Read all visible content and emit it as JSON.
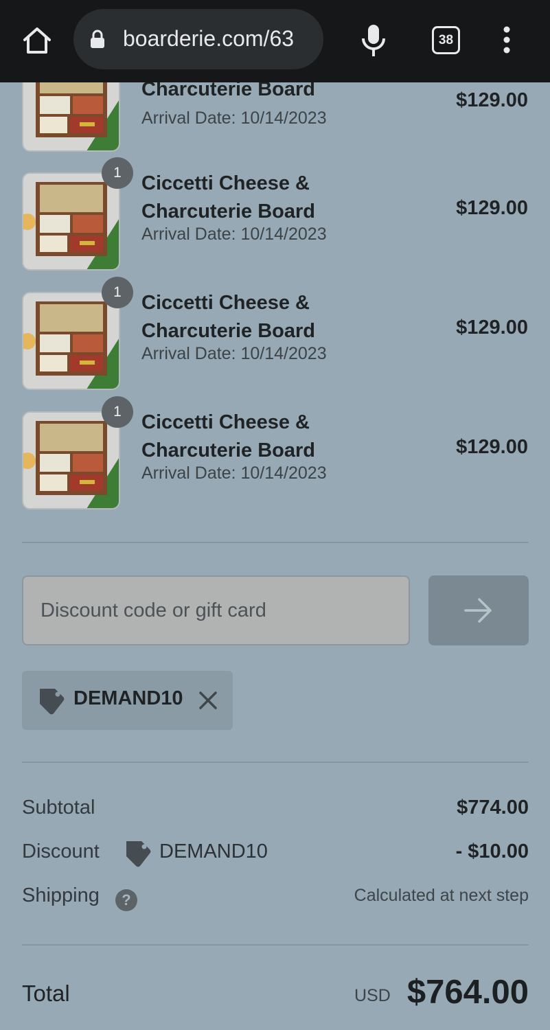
{
  "browser": {
    "url": "boarderie.com/63",
    "tab_count": "38"
  },
  "items": [
    {
      "name": "Charcuterie Board",
      "arrival": "Arrival Date: 10/14/2023",
      "price": "$129.00",
      "quantity": ""
    },
    {
      "name": "Ciccetti Cheese & Charcuterie Board",
      "arrival": "Arrival Date: 10/14/2023",
      "price": "$129.00",
      "quantity": "1"
    },
    {
      "name": "Ciccetti Cheese & Charcuterie Board",
      "arrival": "Arrival Date: 10/14/2023",
      "price": "$129.00",
      "quantity": "1"
    },
    {
      "name": "Ciccetti Cheese & Charcuterie Board",
      "arrival": "Arrival Date: 10/14/2023",
      "price": "$129.00",
      "quantity": "1"
    }
  ],
  "discount": {
    "placeholder": "Discount code or gift card",
    "applied_code": "DEMAND10"
  },
  "summary": {
    "subtotal_label": "Subtotal",
    "subtotal_value": "$774.00",
    "discount_label": "Discount",
    "discount_code": "DEMAND10",
    "discount_value": "- $10.00",
    "shipping_label": "Shipping",
    "shipping_help": "?",
    "shipping_value": "Calculated at next step",
    "total_label": "Total",
    "currency": "USD",
    "total_value": "$764.00"
  },
  "colors": {
    "page_background": "#97a9b4",
    "browser_bar": "#151718",
    "apply_button": "#7b8a92"
  }
}
